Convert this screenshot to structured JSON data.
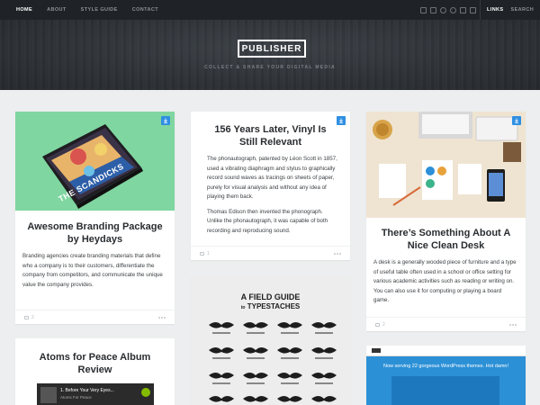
{
  "nav": {
    "links": [
      "HOME",
      "ABOUT",
      "STYLE GUIDE",
      "CONTACT"
    ],
    "active": "HOME",
    "right_links": [
      "LINKS",
      "SEARCH"
    ],
    "social_icons": [
      "twitter-icon",
      "facebook-icon",
      "dribbble-icon",
      "pinterest-icon",
      "rss-icon",
      "linkedin-icon"
    ]
  },
  "hero": {
    "logo": "PUBLISHER",
    "tagline": "COLLECT & SHARE YOUR DIGITAL MEDIA"
  },
  "colors": {
    "accent": "#2f8fe2",
    "topbar": "#1f2327",
    "background": "#eceeef"
  },
  "cards": {
    "branding": {
      "image_text": "THE SCANDICKS",
      "title": "Awesome Branding Package by Heydays",
      "body": "Branding agencies create branding materials that define who a company is to their customers, differentiate the company from competitors, and communicate the unique value the company provides.",
      "comments": "2"
    },
    "vinyl": {
      "title": "156 Years Later, Vinyl Is Still Relevant",
      "body_1": "The phonautograph, patented by Léon Scott in 1857, used a vibrating diaphragm and stylus to graphically record sound waves as tracings on sheets of paper, purely for visual analysis and without any idea of playing them back.",
      "body_2": "Thomas Edison then invented the phonograph. Unlike the phonautograph, it was capable of both recording and reproducing sound.",
      "comments": "1"
    },
    "desk": {
      "title": "There’s Something About A Nice Clean Desk",
      "body": "A desk is a generally wooded piece of furniture and a type of useful table often used in a school or office setting for various academic activities such as reading or writing on. You can also use it for computing or playing a board game.",
      "comments": "2"
    },
    "atoms": {
      "title": "Atoms for Peace Album Review",
      "player_track": "1. Before Your Very Eyes...",
      "player_artist": "Atoms For Peace"
    },
    "fieldguide": {
      "title_1": "A FIELD GUIDE",
      "title_2": "TYPESTACHES",
      "title_prefix": "to"
    },
    "wordpress": {
      "headline": "Now serving 22 gorgeous WordPress themes. Hot damn!"
    }
  }
}
